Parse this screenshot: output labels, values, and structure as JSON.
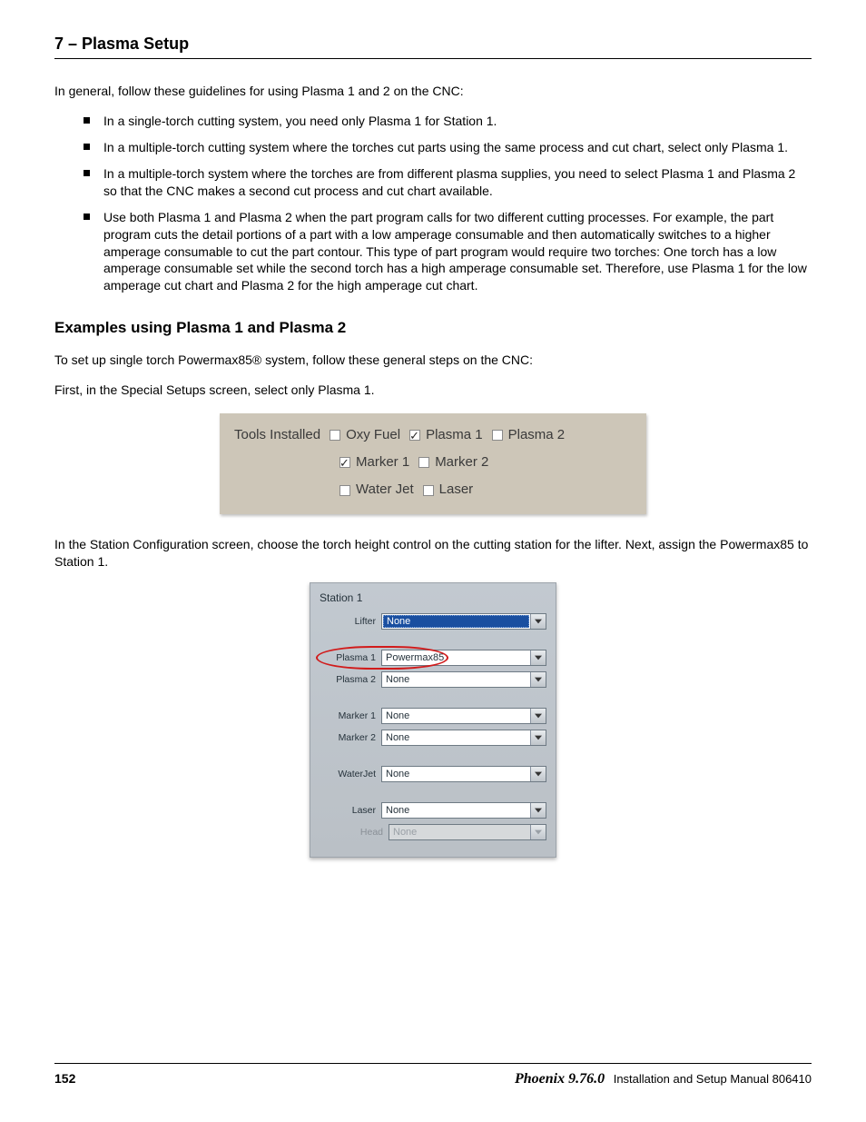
{
  "header": {
    "chapter": "7 – Plasma Setup"
  },
  "intro": "In general, follow these guidelines for using Plasma 1 and 2 on the CNC:",
  "bullets": [
    "In a single-torch cutting system, you need only Plasma 1 for Station 1.",
    "In a multiple-torch cutting system where the torches cut parts using the same process and cut chart, select only Plasma 1.",
    "In a multiple-torch system where the torches are from different plasma supplies, you need to select Plasma 1 and Plasma 2 so that the CNC makes a second cut process and cut chart available.",
    "Use both Plasma 1 and Plasma 2 when the part program calls for two different cutting processes. For example, the part program cuts the detail portions of a part with a low amperage consumable and then automatically switches to a higher amperage consumable to cut the part contour. This type of part program would require two torches: One torch has a low amperage consumable set while the second torch has a high amperage consumable set. Therefore, use Plasma 1 for the low amperage cut chart and Plasma 2 for the high amperage cut chart."
  ],
  "section_heading": "Examples using Plasma 1 and Plasma 2",
  "para_setup": "To set up single torch Powermax85® system, follow these general steps on the CNC:",
  "para_first": "First, in the Special Setups screen, select only Plasma 1.",
  "tools": {
    "label": "Tools Installed",
    "items": {
      "oxyfuel": {
        "label": "Oxy Fuel",
        "checked": false
      },
      "plasma1": {
        "label": "Plasma 1",
        "checked": true
      },
      "plasma2": {
        "label": "Plasma 2",
        "checked": false
      },
      "marker1": {
        "label": "Marker 1",
        "checked": true
      },
      "marker2": {
        "label": "Marker 2",
        "checked": false
      },
      "waterjet": {
        "label": "Water Jet",
        "checked": false
      },
      "laser": {
        "label": "Laser",
        "checked": false
      }
    }
  },
  "para_station": "In the Station Configuration screen, choose the torch height control on the cutting station for the lifter. Next, assign the Powermax85 to Station 1.",
  "station": {
    "title": "Station 1",
    "fields": {
      "lifter": {
        "label": "Lifter",
        "value": "None",
        "highlighted": true
      },
      "plasma1": {
        "label": "Plasma 1",
        "value": "Powermax85"
      },
      "plasma2": {
        "label": "Plasma 2",
        "value": "None"
      },
      "marker1": {
        "label": "Marker 1",
        "value": "None"
      },
      "marker2": {
        "label": "Marker 2",
        "value": "None"
      },
      "waterjet": {
        "label": "WaterJet",
        "value": "None"
      },
      "laser": {
        "label": "Laser",
        "value": "None"
      },
      "head": {
        "label": "Head",
        "value": "None",
        "disabled": true
      }
    }
  },
  "footer": {
    "page": "152",
    "product": "Phoenix 9.76.0",
    "rest": "Installation and Setup Manual  806410"
  }
}
